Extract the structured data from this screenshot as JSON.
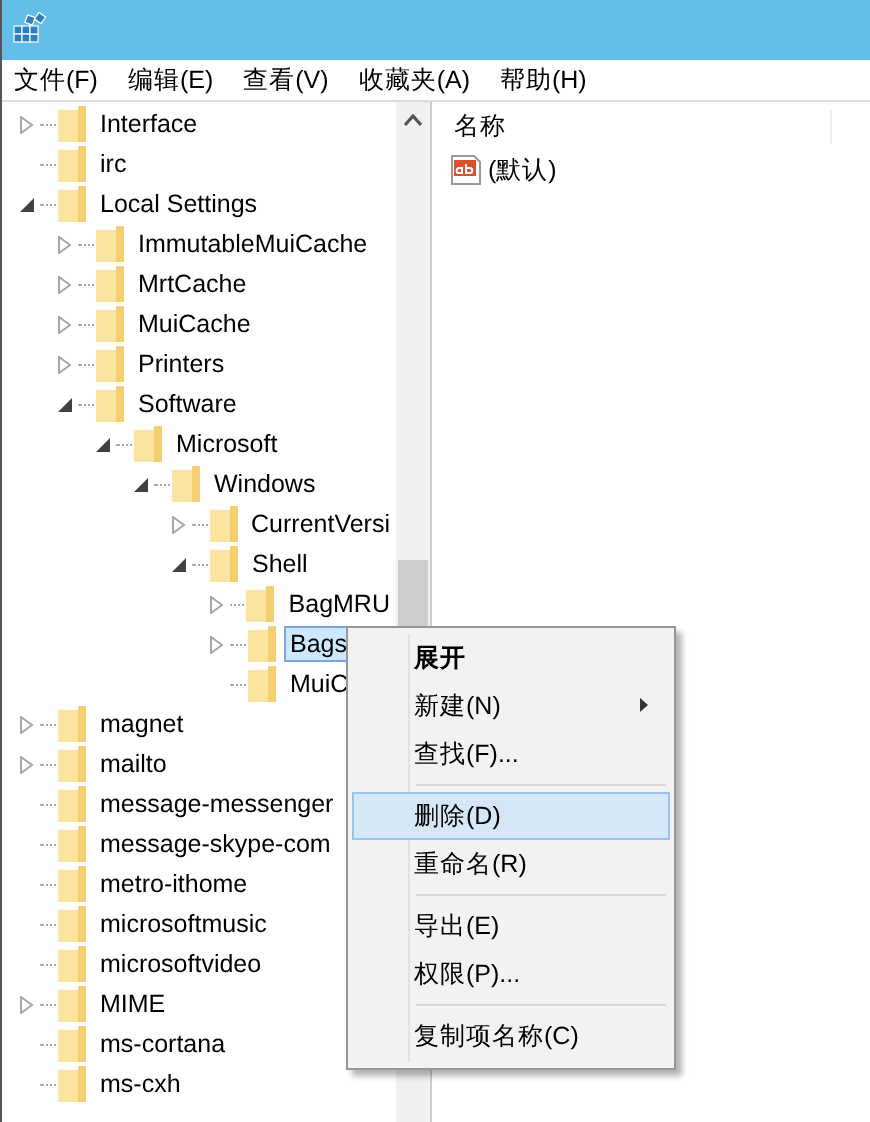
{
  "menubar": [
    {
      "label": "文件(F)"
    },
    {
      "label": "编辑(E)"
    },
    {
      "label": "查看(V)"
    },
    {
      "label": "收藏夹(A)"
    },
    {
      "label": "帮助(H)"
    }
  ],
  "tree": [
    {
      "label": "Interface",
      "kind": "closed",
      "selected": false
    },
    {
      "label": "irc",
      "kind": "leaf",
      "selected": false
    },
    {
      "label": "Local Settings",
      "kind": "open",
      "selected": false,
      "children": [
        {
          "label": "ImmutableMuiCache",
          "kind": "closed",
          "selected": false
        },
        {
          "label": "MrtCache",
          "kind": "closed",
          "selected": false
        },
        {
          "label": "MuiCache",
          "kind": "closed",
          "selected": false
        },
        {
          "label": "Printers",
          "kind": "closed",
          "selected": false
        },
        {
          "label": "Software",
          "kind": "open",
          "selected": false,
          "children": [
            {
              "label": "Microsoft",
              "kind": "open",
              "selected": false,
              "children": [
                {
                  "label": "Windows",
                  "kind": "open",
                  "selected": false,
                  "children": [
                    {
                      "label": "CurrentVersi",
                      "kind": "closed",
                      "selected": false
                    },
                    {
                      "label": "Shell",
                      "kind": "open",
                      "selected": false,
                      "children": [
                        {
                          "label": "BagMRU",
                          "kind": "closed",
                          "selected": false
                        },
                        {
                          "label": "Bags",
                          "kind": "closed",
                          "selected": true
                        },
                        {
                          "label": "MuiC",
                          "kind": "leaf",
                          "selected": false
                        }
                      ]
                    }
                  ]
                }
              ]
            }
          ]
        }
      ]
    },
    {
      "label": "magnet",
      "kind": "closed",
      "selected": false
    },
    {
      "label": "mailto",
      "kind": "closed",
      "selected": false
    },
    {
      "label": "message-messenger",
      "kind": "leaf",
      "selected": false
    },
    {
      "label": "message-skype-com",
      "kind": "leaf",
      "selected": false
    },
    {
      "label": "metro-ithome",
      "kind": "leaf",
      "selected": false
    },
    {
      "label": "microsoftmusic",
      "kind": "leaf",
      "selected": false
    },
    {
      "label": "microsoftvideo",
      "kind": "leaf",
      "selected": false
    },
    {
      "label": "MIME",
      "kind": "closed",
      "selected": false
    },
    {
      "label": "ms-cortana",
      "kind": "leaf",
      "selected": false
    },
    {
      "label": "ms-cxh",
      "kind": "leaf",
      "selected": false
    }
  ],
  "values": {
    "columns": [
      "名称"
    ],
    "rows": [
      {
        "name": "(默认)"
      }
    ]
  },
  "context_menu": [
    {
      "kind": "item",
      "label": "展开",
      "default": true,
      "submenu": false,
      "selected": false
    },
    {
      "kind": "item",
      "label": "新建(N)",
      "default": false,
      "submenu": true,
      "selected": false
    },
    {
      "kind": "item",
      "label": "查找(F)...",
      "default": false,
      "submenu": false,
      "selected": false
    },
    {
      "kind": "separator"
    },
    {
      "kind": "item",
      "label": "删除(D)",
      "default": false,
      "submenu": false,
      "selected": true
    },
    {
      "kind": "item",
      "label": "重命名(R)",
      "default": false,
      "submenu": false,
      "selected": false
    },
    {
      "kind": "separator"
    },
    {
      "kind": "item",
      "label": "导出(E)",
      "default": false,
      "submenu": false,
      "selected": false
    },
    {
      "kind": "item",
      "label": "权限(P)...",
      "default": false,
      "submenu": false,
      "selected": false
    },
    {
      "kind": "separator"
    },
    {
      "kind": "item",
      "label": "复制项名称(C)",
      "default": false,
      "submenu": false,
      "selected": false
    }
  ]
}
